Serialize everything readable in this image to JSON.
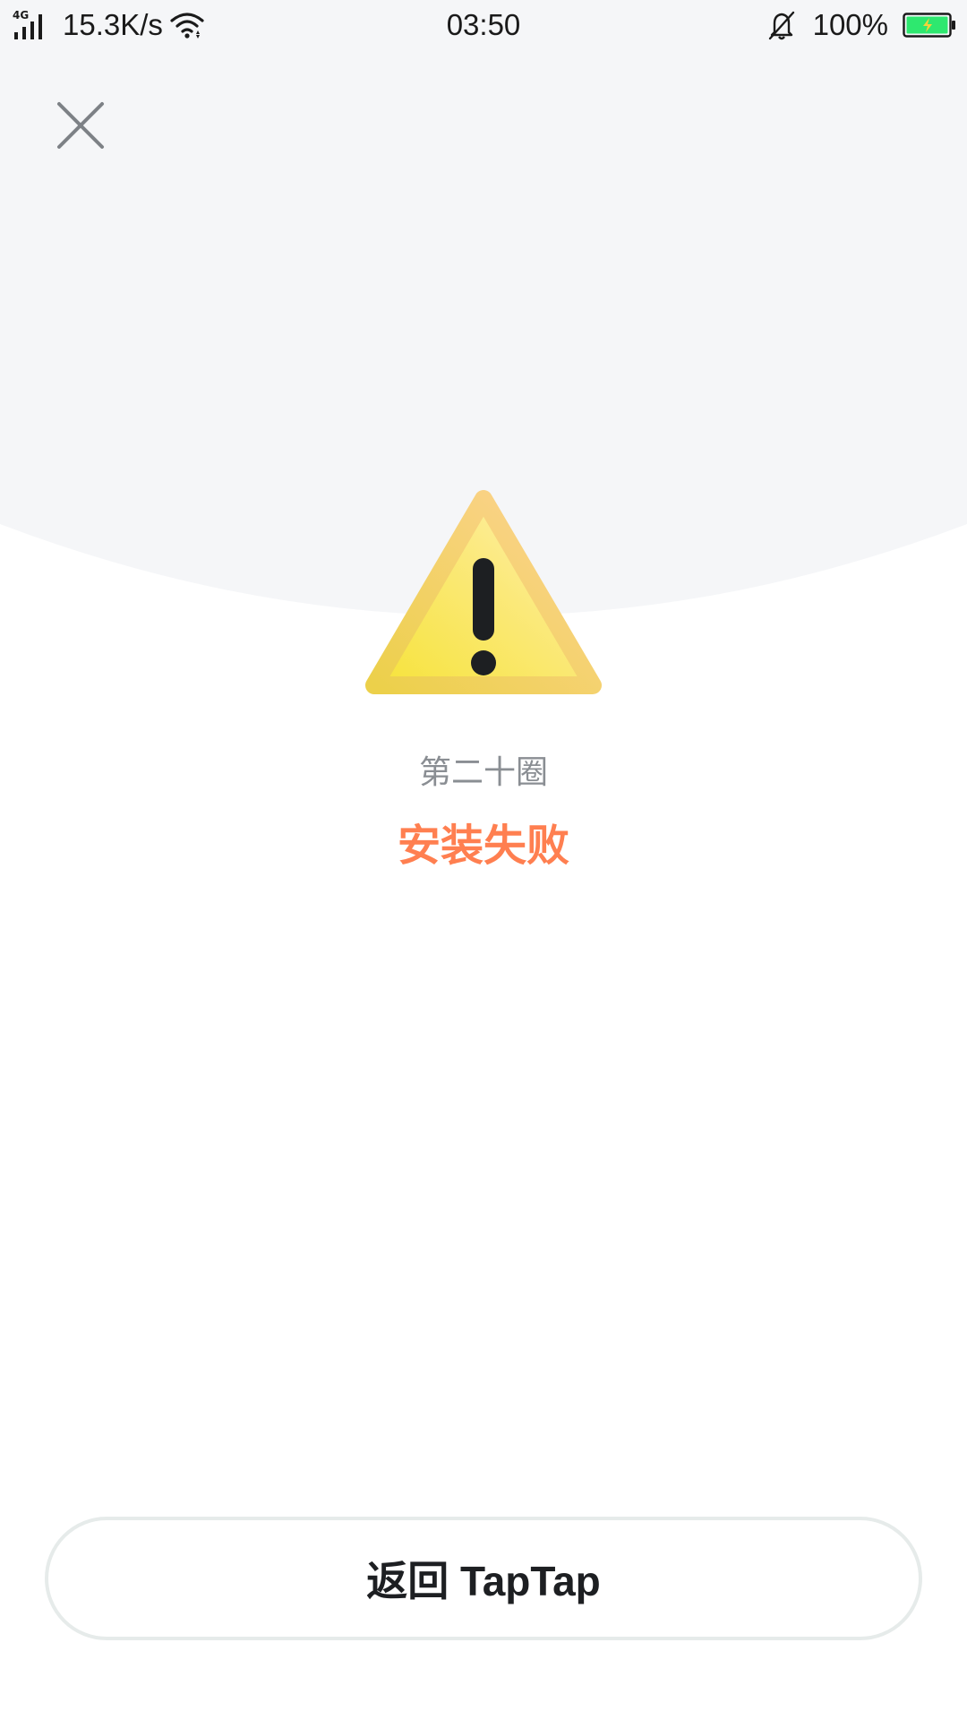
{
  "status_bar": {
    "network_type": "4G",
    "speed": "15.3K/s",
    "time": "03:50",
    "battery_percent": "100%",
    "battery_color": "#2ee86f",
    "icons": [
      "signal-icon",
      "wifi-icon",
      "bell-muted-icon",
      "battery-charging-icon"
    ]
  },
  "header": {
    "close_icon": "close-icon"
  },
  "main": {
    "icon": "warning-icon",
    "app_name": "第二十圈",
    "status": "安装失败",
    "status_color": "#ff7f50"
  },
  "footer": {
    "button_label": "返回 TapTap"
  },
  "colors": {
    "background_top": "#f5f6f8",
    "background": "#ffffff",
    "button_border": "#e6ebea"
  }
}
